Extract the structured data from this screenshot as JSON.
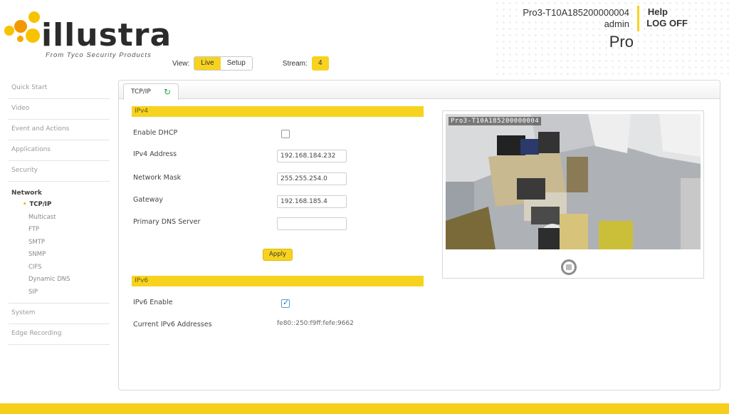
{
  "brand": {
    "logo_text": "illustra",
    "tagline": "From Tyco Security Products"
  },
  "toolbar": {
    "view_label": "View:",
    "live_label": "Live",
    "setup_label": "Setup",
    "stream_label": "Stream:",
    "stream_value": "4"
  },
  "account": {
    "device_name": "Pro3-T10A185200000004",
    "user": "admin",
    "help_label": "Help",
    "logoff_label": "LOG OFF",
    "model": "Pro"
  },
  "sidebar": {
    "items_top": [
      "Quick Start",
      "Video",
      "Event and Actions",
      "Applications",
      "Security"
    ],
    "network_title": "Network",
    "network_items": [
      "TCP/IP",
      "Multicast",
      "FTP",
      "SMTP",
      "SNMP",
      "CIFS",
      "Dynamic DNS",
      "SIP"
    ],
    "items_bottom": [
      "System",
      "Edge Recording"
    ]
  },
  "tab": {
    "label": "TCP/IP",
    "refresh_icon": "refresh-icon"
  },
  "ipv4": {
    "section_title": "IPv4",
    "dhcp_label": "Enable DHCP",
    "dhcp_checked": false,
    "address_label": "IPv4 Address",
    "address_value": "192.168.184.232",
    "mask_label": "Network Mask",
    "mask_value": "255.255.254.0",
    "gateway_label": "Gateway",
    "gateway_value": "192.168.185.4",
    "dns_label": "Primary DNS Server",
    "dns_value": "",
    "apply_label": "Apply"
  },
  "ipv6": {
    "section_title": "IPv6",
    "enable_label": "IPv6 Enable",
    "enable_checked": true,
    "addresses_label": "Current IPv6 Addresses",
    "addresses_value": "fe80::250:f9ff:fefe:9662"
  },
  "video": {
    "overlay_text": "Pro3-T10A185200000004"
  },
  "colors": {
    "accent": "#f7d320",
    "text": "#444444"
  }
}
